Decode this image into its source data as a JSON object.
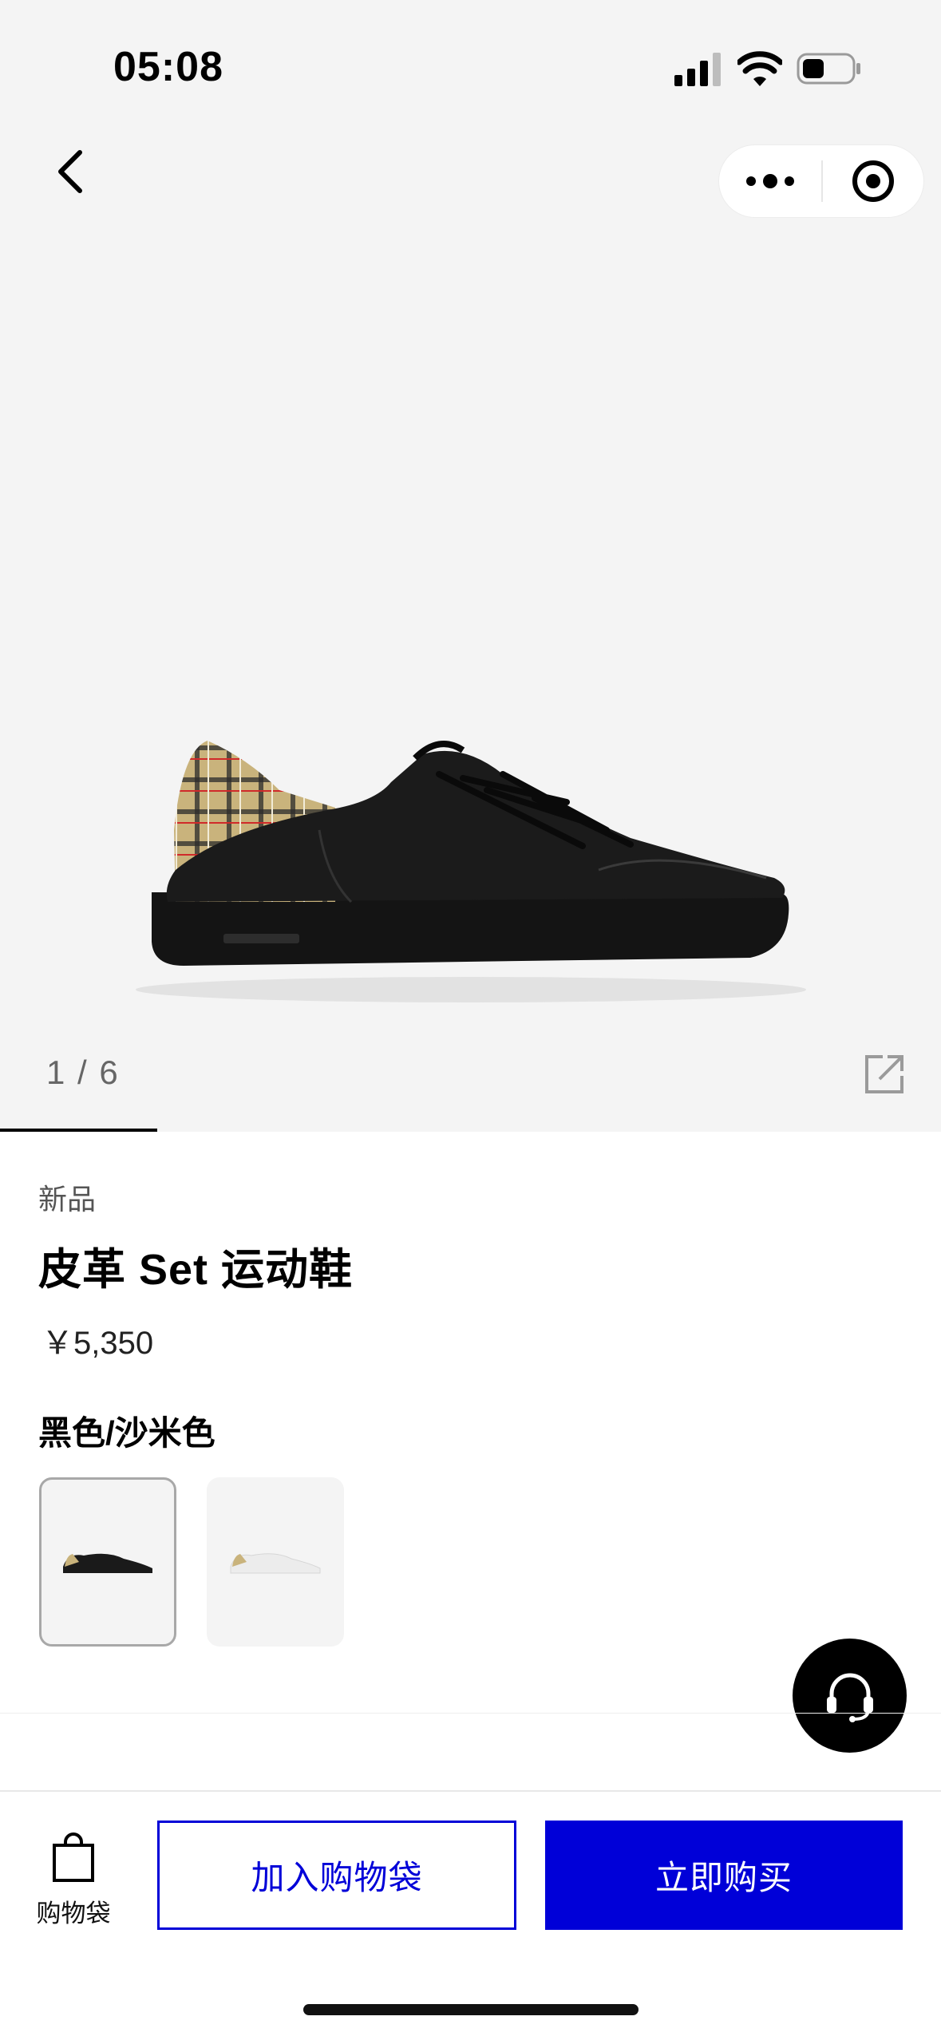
{
  "status_bar": {
    "time": "05:08",
    "signal_icon": "cellular-signal-icon",
    "wifi_icon": "wifi-icon",
    "battery_icon": "battery-icon"
  },
  "nav": {
    "back_icon": "chevron-left-icon",
    "capsule_more_icon": "more-dots-icon",
    "capsule_close_icon": "target-close-icon"
  },
  "gallery": {
    "counter": "1 / 6",
    "current_index": 1,
    "total": 6,
    "share_icon": "external-share-icon"
  },
  "product": {
    "badge": "新品",
    "title": "皮革 Set 运动鞋",
    "price": "￥5,350",
    "color_name": "黑色/沙米色",
    "swatches": [
      {
        "name": "black",
        "selected": true
      },
      {
        "name": "white",
        "selected": false
      }
    ]
  },
  "customer_service": {
    "icon": "headset-icon"
  },
  "bottom_bar": {
    "bag_icon": "shopping-bag-icon",
    "bag_label": "购物袋",
    "add_to_bag_label": "加入购物袋",
    "buy_now_label": "立即购买"
  },
  "colors": {
    "accent": "#0000d8",
    "hero_background": "#f4f4f4"
  }
}
